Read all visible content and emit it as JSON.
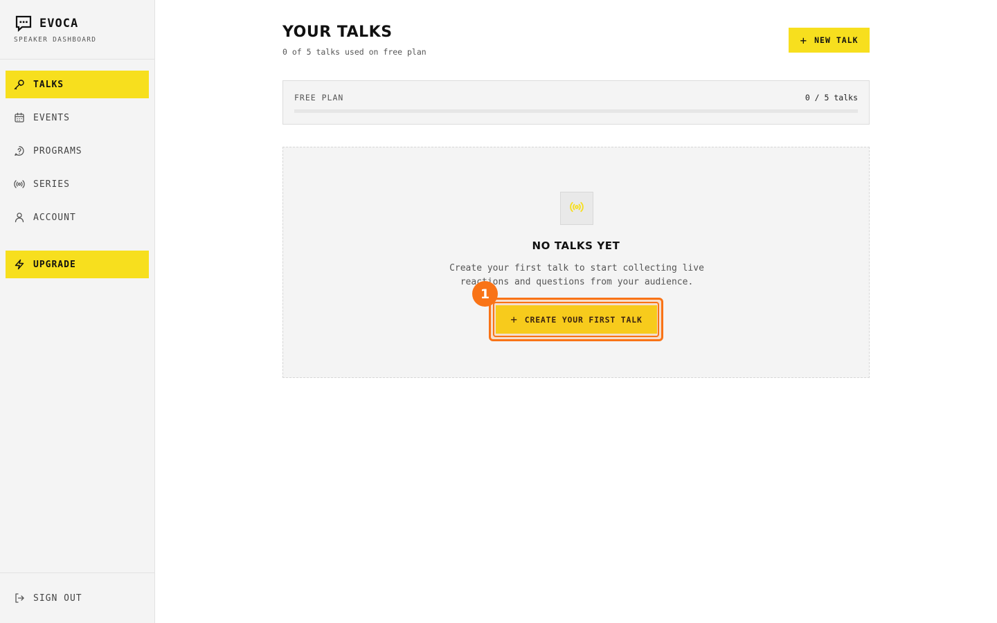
{
  "brand": {
    "name": "EVOCA",
    "subtitle": "SPEAKER DASHBOARD"
  },
  "sidebar": {
    "items": [
      {
        "label": "TALKS",
        "icon": "microphone-icon",
        "active": true
      },
      {
        "label": "EVENTS",
        "icon": "calendar-icon",
        "active": false
      },
      {
        "label": "PROGRAMS",
        "icon": "question-bubble-icon",
        "active": false
      },
      {
        "label": "SERIES",
        "icon": "broadcast-icon",
        "active": false
      },
      {
        "label": "ACCOUNT",
        "icon": "user-icon",
        "active": false
      }
    ],
    "upgrade_label": "UPGRADE",
    "signout_label": "SIGN OUT"
  },
  "header": {
    "title": "YOUR TALKS",
    "subtitle": "0 of 5 talks used on free plan",
    "new_button_label": "NEW TALK"
  },
  "plan": {
    "label": "FREE PLAN",
    "usage_text": "0 / 5 talks",
    "used": 0,
    "limit": 5
  },
  "empty_state": {
    "title": "NO TALKS YET",
    "description": "Create your first talk to start collecting live reactions and questions from your audience.",
    "button_label": "CREATE YOUR FIRST TALK",
    "icon": "broadcast-icon"
  },
  "annotation": {
    "badge_number": "1"
  },
  "colors": {
    "accent": "#f7df1e",
    "highlight": "#f97316",
    "sidebar_bg": "#f4f4f4"
  }
}
